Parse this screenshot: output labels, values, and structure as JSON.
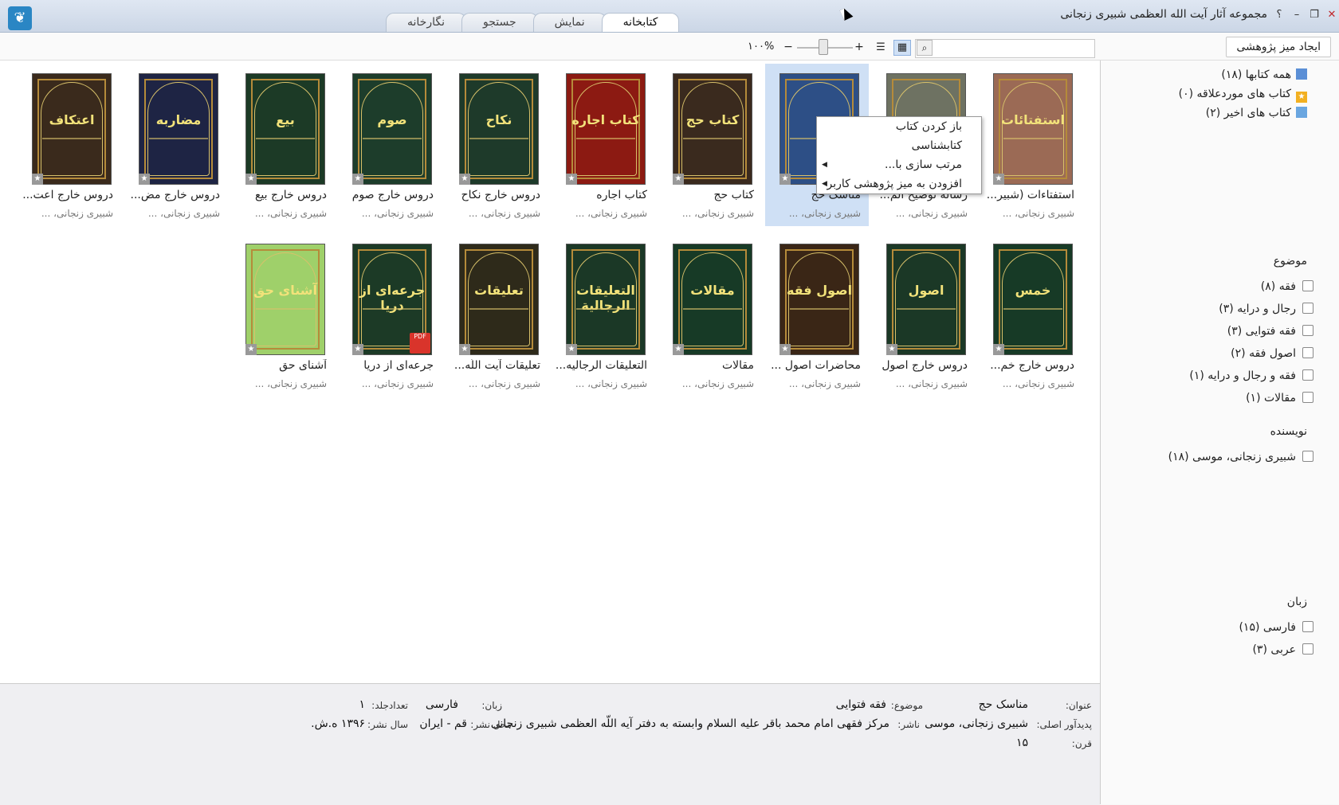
{
  "window": {
    "title": "مجموعه آثار آیت الله العظمی شبیری زنجانی",
    "close": "✕",
    "maximize": "❐",
    "minimize": "–",
    "help": "؟"
  },
  "tabs": [
    {
      "label": "کتابخانه",
      "active": true
    },
    {
      "label": "نمایش",
      "active": false
    },
    {
      "label": "جستجو",
      "active": false
    },
    {
      "label": "نگارخانه",
      "active": false
    }
  ],
  "toolbar": {
    "create_desk": "ایجاد میز پژوهشی",
    "search_placeholder": "",
    "zoom": "۱۰۰%"
  },
  "books": [
    {
      "title": "استفتاءات (شبیر...",
      "author": "شبیری زنجانی، ...",
      "cover_text": "استفتائات",
      "cover_color": "#9b6a55"
    },
    {
      "title": "رساله توضیح الم...",
      "author": "شبیری زنجانی، ...",
      "cover_text": "",
      "cover_color": "#6e7262"
    },
    {
      "title": "مناسک حج",
      "author": "شبیری زنجانی، ...",
      "cover_text": "",
      "cover_color": "#2d4f86",
      "selected": true
    },
    {
      "title": "کتاب حج",
      "author": "شبیری زنجانی، ...",
      "cover_text": "کتاب حج",
      "cover_color": "#3a2a1e"
    },
    {
      "title": "کتاب اجاره",
      "author": "شبیری زنجانی، ...",
      "cover_text": "کتاب اجاره",
      "cover_color": "#8c1a12"
    },
    {
      "title": "دروس خارج نکاح",
      "author": "شبیری زنجانی، ...",
      "cover_text": "نکاح",
      "cover_color": "#1e3a2a"
    },
    {
      "title": "دروس خارج صوم",
      "author": "شبیری زنجانی، ...",
      "cover_text": "صوم",
      "cover_color": "#1d3d2b"
    },
    {
      "title": "دروس خارج بیع",
      "author": "شبیری زنجانی، ...",
      "cover_text": "بیع",
      "cover_color": "#1c3a26"
    },
    {
      "title": "دروس خارج مض...",
      "author": "شبیری زنجانی، ...",
      "cover_text": "مضاربه",
      "cover_color": "#1e2444"
    },
    {
      "title": "دروس خارج اعت...",
      "author": "شبیری زنجانی، ...",
      "cover_text": "اعتکاف",
      "cover_color": "#3a2a1c"
    },
    {
      "title": "دروس خارج خم...",
      "author": "شبیری زنجانی، ...",
      "cover_text": "خمس",
      "cover_color": "#173a26"
    },
    {
      "title": "دروس خارج اصول",
      "author": "شبیری زنجانی، ...",
      "cover_text": "اصول",
      "cover_color": "#1b3826"
    },
    {
      "title": "محاضرات اصول ...",
      "author": "شبیری زنجانی، ...",
      "cover_text": "اصول فقه",
      "cover_color": "#3a2616"
    },
    {
      "title": "مقالات",
      "author": "شبیری زنجانی، ...",
      "cover_text": "مقالات",
      "cover_color": "#173a26"
    },
    {
      "title": "التعلیقات الرجالیه...",
      "author": "شبیری زنجانی، ...",
      "cover_text": "التعلیقات الرجالیة",
      "cover_color": "#1b3826"
    },
    {
      "title": "تعلیقات آیت اللّه...",
      "author": "شبیری زنجانی، ...",
      "cover_text": "تعلیقات",
      "cover_color": "#2e2a1a"
    },
    {
      "title": "جرعه‌ای از دریا",
      "author": "شبیری زنجانی، ...",
      "cover_text": "جرعه‌ای از دریا",
      "cover_color": "#1c3a26",
      "pdf": true
    },
    {
      "title": "آشنای حق",
      "author": "شبیری زنجانی، ...",
      "cover_text": "آشنای حق",
      "cover_color": "#9fd06a"
    }
  ],
  "context_menu": [
    {
      "label": "باز کردن کتاب",
      "submenu": false
    },
    {
      "label": "کتابشناسی",
      "submenu": false
    },
    {
      "label": "مرتب سازی با...",
      "submenu": true
    },
    {
      "label": "افزودن به میز پژوهشی کاربر",
      "submenu": true
    }
  ],
  "sidebar": {
    "nav": [
      {
        "label": "همه کتابها (۱۸)",
        "icon": "books-icon",
        "color": "#5b8fd6"
      },
      {
        "label": "کتاب های موردعلاقه (۰)",
        "icon": "star-icon",
        "color": "#f2b021"
      },
      {
        "label": "کتاب های اخیر (۲)",
        "icon": "recent-book-icon",
        "color": "#6aa6e0"
      }
    ],
    "facets": [
      {
        "heading": "موضوع",
        "items": [
          "فقه (۸)",
          "رجال و درایه (۳)",
          "فقه فتوایی (۳)",
          "اصول فقه (۲)",
          "فقه و رجال و درایه (۱)",
          "مقالات (۱)"
        ]
      },
      {
        "heading": "نویسنده",
        "items": [
          "شبیری زنجانی، موسی (۱۸)"
        ]
      },
      {
        "heading": "زبان",
        "items": [
          "فارسی (۱۵)",
          "عربی (۳)"
        ]
      }
    ]
  },
  "details": {
    "title_label": "عنوان:",
    "title_value": "مناسک حج",
    "subject_label": "موضوع:",
    "subject_value": "فقه فتوایی",
    "language_label": "زبان:",
    "language_value": "فارسی",
    "volumes_label": "تعدادجلد:",
    "volumes_value": "۱",
    "creator_label": "پدیدآور اصلی:",
    "creator_value": "شبیری زنجانی، موسی",
    "publisher_label": "ناشر:",
    "publisher_value": "مرکز فقهی امام محمد باقر علیه السلام وابسته به دفتر آیه اللّه العظمی شبیری زنجانی",
    "place_label": "محل نشر:",
    "place_value": "قم - ایران",
    "year_label": "سال نشر:",
    "year_value": "۱۳۹۶ ه.ش.",
    "century_label": "قرن:",
    "century_value": "۱۵"
  }
}
